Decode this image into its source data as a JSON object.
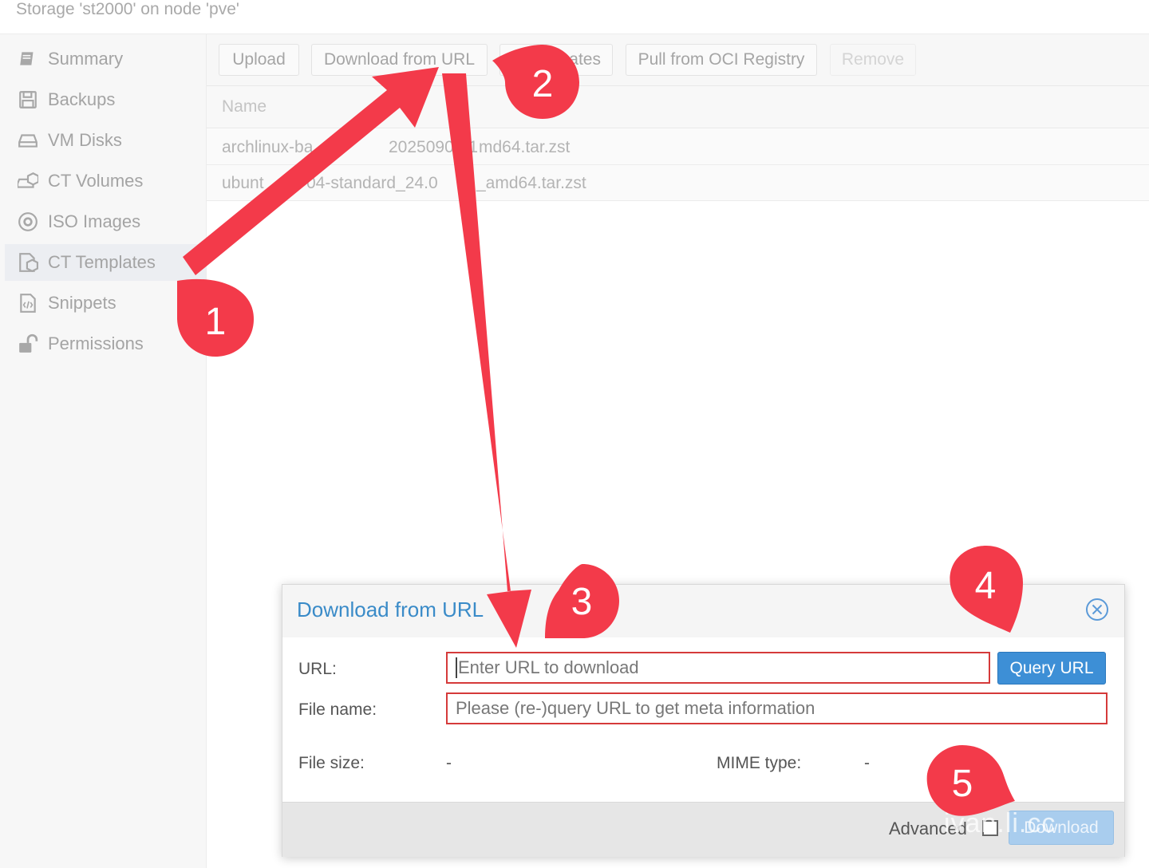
{
  "header": {
    "title": "Storage 'st2000' on node 'pve'"
  },
  "sidebar": {
    "items": [
      {
        "label": "Summary",
        "icon": "book-icon"
      },
      {
        "label": "Backups",
        "icon": "floppy-icon"
      },
      {
        "label": "VM Disks",
        "icon": "hard-drive-icon"
      },
      {
        "label": "CT Volumes",
        "icon": "container-volume-icon"
      },
      {
        "label": "ISO Images",
        "icon": "disc-icon"
      },
      {
        "label": "CT Templates",
        "icon": "template-icon",
        "active": true
      },
      {
        "label": "Snippets",
        "icon": "code-file-icon"
      },
      {
        "label": "Permissions",
        "icon": "unlock-icon"
      }
    ]
  },
  "toolbar": {
    "upload": "Upload",
    "download_url": "Download from URL",
    "templates": "ates",
    "pull_oci": "Pull from OCI Registry",
    "remove": "Remove"
  },
  "grid": {
    "column": "Name",
    "rows": [
      {
        "left": "archlinux-ba",
        "right": "20250907-1",
        "tail": "md64.tar.zst"
      },
      {
        "left": "ubunt",
        "right": "04-standard_24.0",
        "tail": "_amd64.tar.zst"
      }
    ]
  },
  "dialog": {
    "title": "Download from URL",
    "url_label": "URL:",
    "url_placeholder": "Enter URL to download",
    "query_button": "Query URL",
    "filename_label": "File name:",
    "filename_placeholder": "Please (re-)query URL to get meta information",
    "filesize_label": "File size:",
    "filesize_value": "-",
    "mime_label": "MIME type:",
    "mime_value": "-",
    "advanced_label": "Advanced",
    "download_button": "Download"
  },
  "annotations": {
    "badge1": "1",
    "badge2": "2",
    "badge3": "3",
    "badge4": "4",
    "badge5": "5",
    "color": "#f33a4a"
  },
  "watermark": "ivan.li.cc"
}
